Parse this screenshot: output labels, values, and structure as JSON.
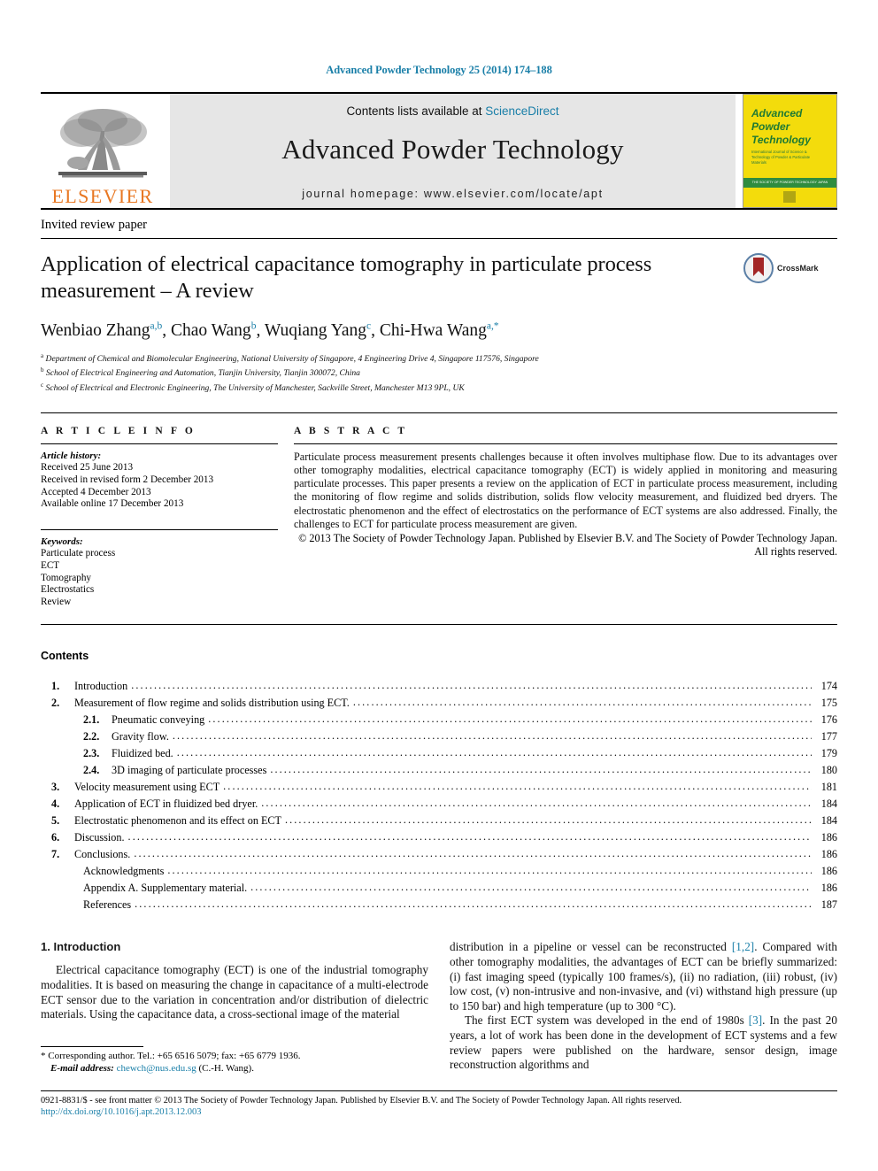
{
  "running_head": "Advanced Powder Technology 25 (2014) 174–188",
  "masthead": {
    "publisher_name": "ELSEVIER",
    "contents_prefix": "Contents lists available at ",
    "sciencedirect": "ScienceDirect",
    "journal_name": "Advanced Powder Technology",
    "homepage": "journal homepage: www.elsevier.com/locate/apt",
    "cover": {
      "title_line1": "Advanced",
      "title_line2": "Powder",
      "title_line3": "Technology",
      "subtitle": "International Journal of Science & Technology of Powder & Particulate Materials",
      "band_text": "THE SOCIETY OF POWDER TECHNOLOGY JAPAN"
    }
  },
  "article": {
    "type": "Invited review paper",
    "title": "Application of electrical capacitance tomography in particulate process measurement – A review",
    "crossmark_label": "CrossMark",
    "authors": [
      {
        "name": "Wenbiao Zhang",
        "sup": "a,b",
        "sep": ", "
      },
      {
        "name": "Chao Wang",
        "sup": "b",
        "sep": ", "
      },
      {
        "name": "Wuqiang Yang",
        "sup": "c",
        "sep": ", "
      },
      {
        "name": "Chi-Hwa Wang",
        "sup": "a,*",
        "sep": ""
      }
    ],
    "affiliations": [
      {
        "mark": "a",
        "text": "Department of Chemical and Biomolecular Engineering, National University of Singapore, 4 Engineering Drive 4, Singapore 117576, Singapore"
      },
      {
        "mark": "b",
        "text": "School of Electrical Engineering and Automation, Tianjin University, Tianjin 300072, China"
      },
      {
        "mark": "c",
        "text": "School of Electrical and Electronic Engineering, The University of Manchester, Sackville Street, Manchester M13 9PL, UK"
      }
    ]
  },
  "article_info": {
    "heading": "A R T I C L E  I N F O",
    "history_label": "Article history:",
    "history": [
      "Received 25 June 2013",
      "Received in revised form 2 December 2013",
      "Accepted 4 December 2013",
      "Available online 17 December 2013"
    ],
    "keywords_label": "Keywords:",
    "keywords": [
      "Particulate process",
      "ECT",
      "Tomography",
      "Electrostatics",
      "Review"
    ]
  },
  "abstract": {
    "heading": "A B S T R A C T",
    "text": "Particulate process measurement presents challenges because it often involves multiphase flow. Due to its advantages over other tomography modalities, electrical capacitance tomography (ECT) is widely applied in monitoring and measuring particulate processes. This paper presents a review on the application of ECT in particulate process measurement, including the monitoring of flow regime and solids distribution, solids flow velocity measurement, and fluidized bed dryers. The electrostatic phenomenon and the effect of electrostatics on the performance of ECT systems are also addressed. Finally, the challenges to ECT for particulate process measurement are given.",
    "copyright": "© 2013 The Society of Powder Technology Japan. Published by Elsevier B.V. and The Society of Powder Technology Japan. All rights reserved."
  },
  "contents": {
    "heading": "Contents",
    "entries": [
      {
        "num": "1.",
        "level": 0,
        "label": "Introduction",
        "page": "174"
      },
      {
        "num": "2.",
        "level": 0,
        "label": "Measurement of flow regime and solids distribution using ECT.",
        "page": "175"
      },
      {
        "num": "2.1.",
        "level": 1,
        "label": "Pneumatic conveying",
        "page": "176"
      },
      {
        "num": "2.2.",
        "level": 1,
        "label": "Gravity flow.",
        "page": "177"
      },
      {
        "num": "2.3.",
        "level": 1,
        "label": "Fluidized bed.",
        "page": "179"
      },
      {
        "num": "2.4.",
        "level": 1,
        "label": "3D imaging of particulate processes",
        "page": "180"
      },
      {
        "num": "3.",
        "level": 0,
        "label": "Velocity measurement using ECT",
        "page": "181"
      },
      {
        "num": "4.",
        "level": 0,
        "label": "Application of ECT in fluidized bed dryer.",
        "page": "184"
      },
      {
        "num": "5.",
        "level": 0,
        "label": "Electrostatic phenomenon and its effect on ECT",
        "page": "184"
      },
      {
        "num": "6.",
        "level": 0,
        "label": "Discussion.",
        "page": "186"
      },
      {
        "num": "7.",
        "level": 0,
        "label": "Conclusions.",
        "page": "186"
      },
      {
        "num": "",
        "level": 1,
        "label": "Acknowledgments",
        "page": "186"
      },
      {
        "num": "",
        "level": 1,
        "label": "Appendix A. Supplementary material.",
        "page": "186"
      },
      {
        "num": "",
        "level": 1,
        "label": "References",
        "page": "187"
      }
    ]
  },
  "intro": {
    "heading": "1. Introduction",
    "left_para": "Electrical capacitance tomography (ECT) is one of the industrial tomography modalities. It is based on measuring the change in capacitance of a multi-electrode ECT sensor due to the variation in concentration and/or distribution of dielectric materials. Using the capacitance data, a cross-sectional image of the material",
    "right_para1_a": "distribution in a pipeline or vessel can be reconstructed ",
    "right_para1_ref": "[1,2]",
    "right_para1_b": ". Compared with other tomography modalities, the advantages of ECT can be briefly summarized: (i) fast imaging speed (typically 100 frames/s), (ii) no radiation, (iii) robust, (iv) low cost, (v) non-intrusive and non-invasive, and (vi) withstand high pressure (up to 150 bar) and high temperature (up to 300 °C).",
    "right_para2_a": "The first ECT system was developed in the end of 1980s ",
    "right_para2_ref": "[3]",
    "right_para2_b": ". In the past 20 years, a lot of work has been done in the development of ECT systems and a few review papers were published on the hardware, sensor design, image reconstruction algorithms and"
  },
  "footnote": {
    "marker": "*",
    "line1": "Corresponding author. Tel.: +65 6516 5079; fax: +65 6779 1936.",
    "email_label": "E-mail address:",
    "email": "chewch@nus.edu.sg",
    "email_suffix": "(C.-H. Wang)."
  },
  "bottom": {
    "issn_line": "0921-8831/$ - see front matter © 2013 The Society of Powder Technology Japan. Published by Elsevier B.V. and The Society of Powder Technology Japan. All rights reserved.",
    "doi": "http://dx.doi.org/10.1016/j.apt.2013.12.003"
  },
  "colors": {
    "link": "#1a7fa8",
    "elsevier_orange": "#E87722",
    "cover_yellow": "#F3DC0C",
    "cover_green": "#2f8c3f",
    "masthead_grey": "#e6e6e6"
  }
}
